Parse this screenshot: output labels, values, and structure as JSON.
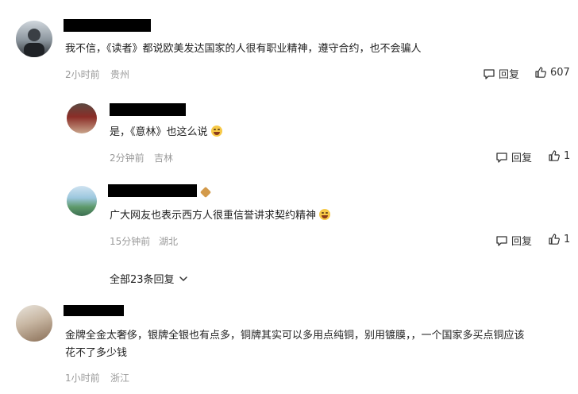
{
  "comments": [
    {
      "text": "我不信，《读者》都说欧美发达国家的人很有职业精神，遵守合约，也不会骗人",
      "time": "2小时前",
      "location": "贵州",
      "reply_label": "回复",
      "likes": "607",
      "avatar_icon": "user-avatar-icon",
      "replies": [
        {
          "text": "是，《意林》也这么说",
          "time": "2分钟前",
          "location": "吉林",
          "reply_label": "回复",
          "likes": "1",
          "emoji": "smile-emoji"
        },
        {
          "text": "广大网友也表示西方人很重信誉讲求契约精神",
          "time": "15分钟前",
          "location": "湖北",
          "reply_label": "回复",
          "likes": "1",
          "emoji": "laugh-emoji"
        }
      ],
      "expand_label": "全部23条回复"
    },
    {
      "text_line1": "金牌全金太奢侈，银牌全银也有点多，铜牌其实可以多用点纯铜，别用镀膜，，一个国家多买点铜应该",
      "text_line2": "花不了多少钱",
      "time": "1小时前",
      "location": "浙江"
    }
  ],
  "colors": {
    "text": "#222222",
    "meta": "#9a9a9a",
    "redaction": "#000000"
  },
  "icons": [
    "comment-icon",
    "thumbs-up-icon",
    "chevron-down-icon"
  ]
}
